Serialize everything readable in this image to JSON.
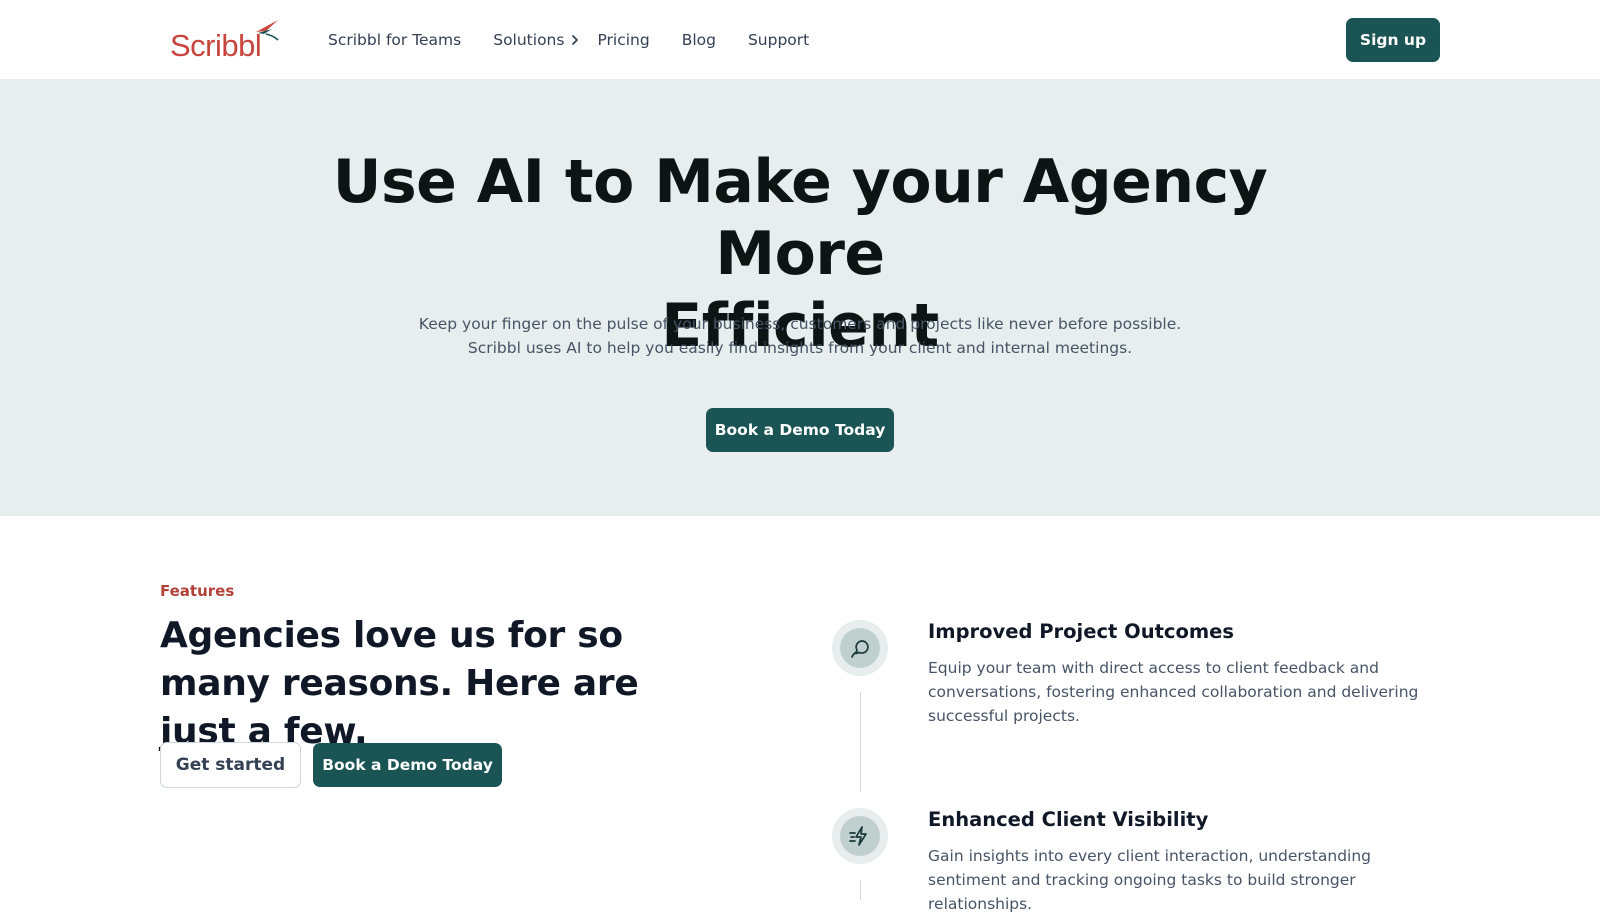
{
  "brand": {
    "name": "Scribbl",
    "logo_color": "#c8453d",
    "accent_color": "#1a5454"
  },
  "nav": {
    "items": [
      {
        "label": "Scribbl for Teams"
      },
      {
        "label": "Solutions",
        "icon": "chevron-right-icon"
      },
      {
        "label": "Pricing"
      },
      {
        "label": "Blog"
      },
      {
        "label": "Support"
      }
    ],
    "signup_label": "Sign up"
  },
  "hero": {
    "title_line1": "Use AI to Make your Agency More",
    "title_line2": "Efficient",
    "subtitle_line1": "Keep your finger on the pulse of your business, customers and projects like never before possible.",
    "subtitle_line2": "Scribbl uses AI to help you easily find insights from your client and internal meetings.",
    "cta_label": "Book a Demo Today"
  },
  "features": {
    "eyebrow": "Features",
    "heading": "Agencies love us for so many reasons. Here are just a few.",
    "get_started_label": "Get started",
    "demo_label": "Book a Demo Today",
    "items": [
      {
        "icon": "message-chat-icon",
        "title": "Improved Project Outcomes",
        "description": "Equip your team with direct access to client feedback and conversations, fostering enhanced collaboration and delivering successful projects."
      },
      {
        "icon": "lightning-fast-icon",
        "title": "Enhanced Client Visibility",
        "description": "Gain insights into every client interaction, understanding sentiment and tracking ongoing tasks to build stronger relationships."
      }
    ]
  }
}
